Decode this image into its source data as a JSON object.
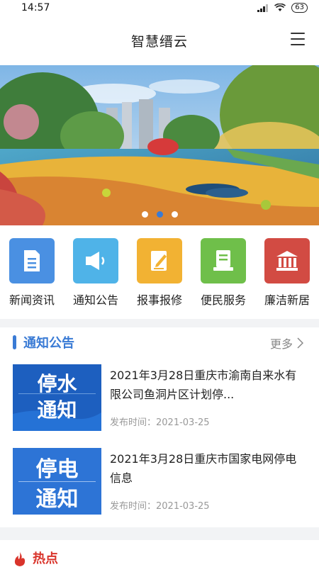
{
  "status": {
    "time": "14:57",
    "battery": "63"
  },
  "header": {
    "title": "智慧缙云"
  },
  "banner": {
    "dot_count": 3,
    "active_dot": 2
  },
  "quick": [
    {
      "label": "新闻资讯",
      "icon": "document-icon",
      "color": "#4a90e2"
    },
    {
      "label": "通知公告",
      "icon": "megaphone-icon",
      "color": "#4fb3e8"
    },
    {
      "label": "报事报修",
      "icon": "edit-note-icon",
      "color": "#f2b233"
    },
    {
      "label": "便民服务",
      "icon": "service-list-icon",
      "color": "#6fbf4a"
    },
    {
      "label": "廉洁新居",
      "icon": "bank-icon",
      "color": "#d24b43"
    }
  ],
  "notice": {
    "title": "通知公告",
    "more": "更多",
    "items": [
      {
        "thumb_line1": "停水",
        "thumb_line2": "通知",
        "title": "2021年3月28日重庆市渝南自来水有限公司鱼洞片区计划停...",
        "date": "发布时间：2021-03-25"
      },
      {
        "thumb_line1": "停电",
        "thumb_line2": "通知",
        "title": "2021年3月28日重庆市国家电网停电信息",
        "date": "发布时间：2021-03-25"
      }
    ]
  },
  "hot": {
    "title": "热点"
  }
}
